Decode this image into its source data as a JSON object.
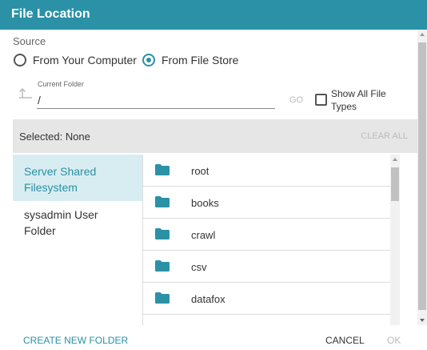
{
  "dialog": {
    "title": "File Location"
  },
  "source": {
    "label": "Source",
    "options": [
      "From Your Computer",
      "From File Store"
    ],
    "selected": "From File Store"
  },
  "folder": {
    "label": "Current Folder",
    "value": "/",
    "go_label": "GO",
    "show_all_label": "Show All File Types",
    "show_all_checked": false
  },
  "selection": {
    "text": "Selected:  None",
    "clear_label": "CLEAR ALL"
  },
  "locations": [
    "Server Shared Filesystem",
    "sysadmin User Folder"
  ],
  "active_location": "Server Shared Filesystem",
  "files": [
    "root",
    "books",
    "crawl",
    "csv",
    "datafox"
  ],
  "footer": {
    "create_label": "CREATE NEW FOLDER",
    "cancel_label": "CANCEL",
    "ok_label": "OK"
  },
  "colors": {
    "accent": "#2a91a6",
    "active_bg": "#d8edf2"
  }
}
